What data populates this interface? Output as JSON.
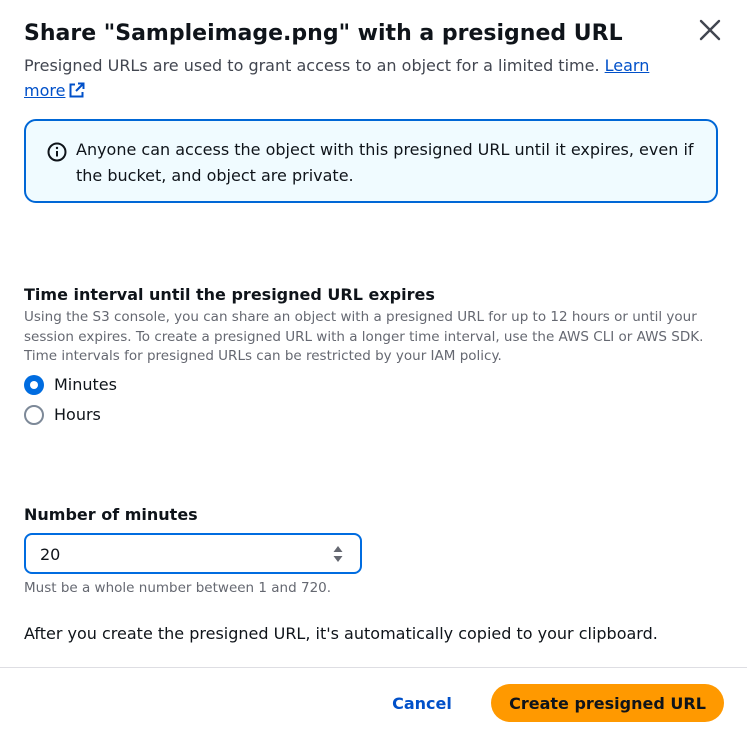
{
  "modal": {
    "title": "Share \"Sampleimage.png\" with a presigned URL",
    "subtitle": "Presigned URLs are used to grant access to an object for a limited time. ",
    "learn_more_label": "Learn more",
    "close_label": "Close"
  },
  "alert": {
    "text": "Anyone can access the object with this presigned URL until it expires, even if the bucket, and object are private."
  },
  "time_interval": {
    "label": "Time interval until the presigned URL expires",
    "description": "Using the S3 console, you can share an object with a presigned URL for up to 12 hours or until your session expires. To create a presigned URL with a longer time interval, use the AWS CLI or AWS SDK. Time intervals for presigned URLs can be restricted by your IAM policy.",
    "options": [
      {
        "label": "Minutes",
        "selected": true
      },
      {
        "label": "Hours",
        "selected": false
      }
    ]
  },
  "number_of_minutes": {
    "label": "Number of minutes",
    "value": "20",
    "constraint": "Must be a whole number between 1 and 720."
  },
  "note": "After you create the presigned URL, it's automatically copied to your clipboard.",
  "footer": {
    "cancel_label": "Cancel",
    "primary_label": "Create presigned URL"
  },
  "colors": {
    "accent": "#006ce0",
    "link": "#0050c9",
    "primary_button": "#ff9900",
    "alert_background": "#f0fbff",
    "alert_border": "#0067d6"
  },
  "icons": {
    "close": "close-icon",
    "external_link": "external-link-icon",
    "info": "info-icon",
    "stepper": "stepper-icon"
  }
}
